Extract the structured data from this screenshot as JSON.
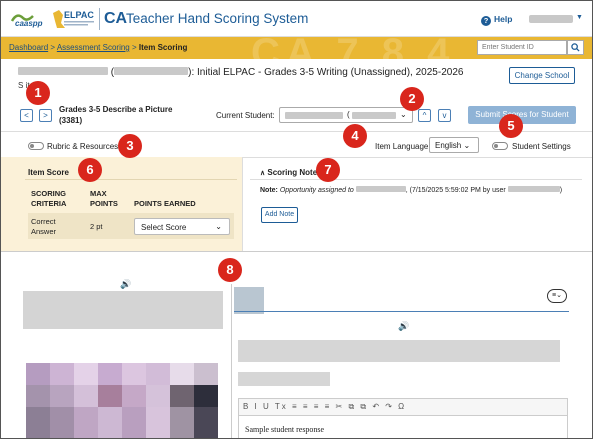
{
  "header": {
    "app_title": "Teacher Hand Scoring System",
    "logo_caaspp": "caaspp",
    "logo_elpac": "ELPAC",
    "logo_ca": "CA",
    "help_label": "Help"
  },
  "breadcrumb": {
    "items": [
      "Dashboard",
      "Assessment Scoring"
    ],
    "current": "Item Scoring",
    "separator": ">"
  },
  "student_search": {
    "placeholder": "Enter Student ID"
  },
  "student_header": {
    "open_paren": "(",
    "test_title": "): Initial ELPAC - Grades 3-5 Writing (Unassigned), 2025-2026",
    "subtitle": "S     item."
  },
  "change_school_label": "Change School",
  "item": {
    "name": "Grades 3-5 Describe a Picture",
    "id": "(3381)",
    "prev_symbol": "<",
    "next_symbol": ">"
  },
  "current_student": {
    "label": "Current Student:",
    "value_suffix": "(",
    "up_symbol": "^",
    "down_symbol": "v"
  },
  "submit_label": "Submit Scores for Student",
  "toolbar": {
    "rubric_label": "Rubric & Resources",
    "item_language_label": "Item Language:",
    "item_language_value": "English",
    "student_settings_label": "Student Settings"
  },
  "score_panel": {
    "title": "Item Score",
    "headers": [
      "SCORING CRITERIA",
      "MAX POINTS",
      "POINTS EARNED"
    ],
    "rows": [
      {
        "criteria": "Correct Answer",
        "max_points": "2 pt",
        "points_earned": "Select Score"
      }
    ]
  },
  "notes": {
    "title": "Scoring Notes",
    "note_prefix": "Note:",
    "note_text_1": "Opportunity assigned to",
    "note_text_2": ", (7/15/2025 5:59:02 PM by user",
    "note_text_3": ")",
    "add_note_label": "Add Note"
  },
  "editor": {
    "toolbar_glyphs": "B I U Tx ≡ ≡ ≡ ≡ ✂ ⧉ ⧉ ↶ ↷ Ω",
    "body_text": "Sample student response"
  },
  "callouts": [
    "1",
    "2",
    "3",
    "4",
    "5",
    "6",
    "7",
    "8"
  ],
  "colors": {
    "brand_blue": "#1d5c96",
    "crumb_bar": "#e9b733",
    "callout_red": "#d9261c",
    "score_panel_bg": "#fbf1d8",
    "submit_disabled": "#8fb3d6"
  },
  "icons": [
    "help-icon",
    "search-icon",
    "chevron-down-icon",
    "speaker-icon",
    "list-icon"
  ]
}
